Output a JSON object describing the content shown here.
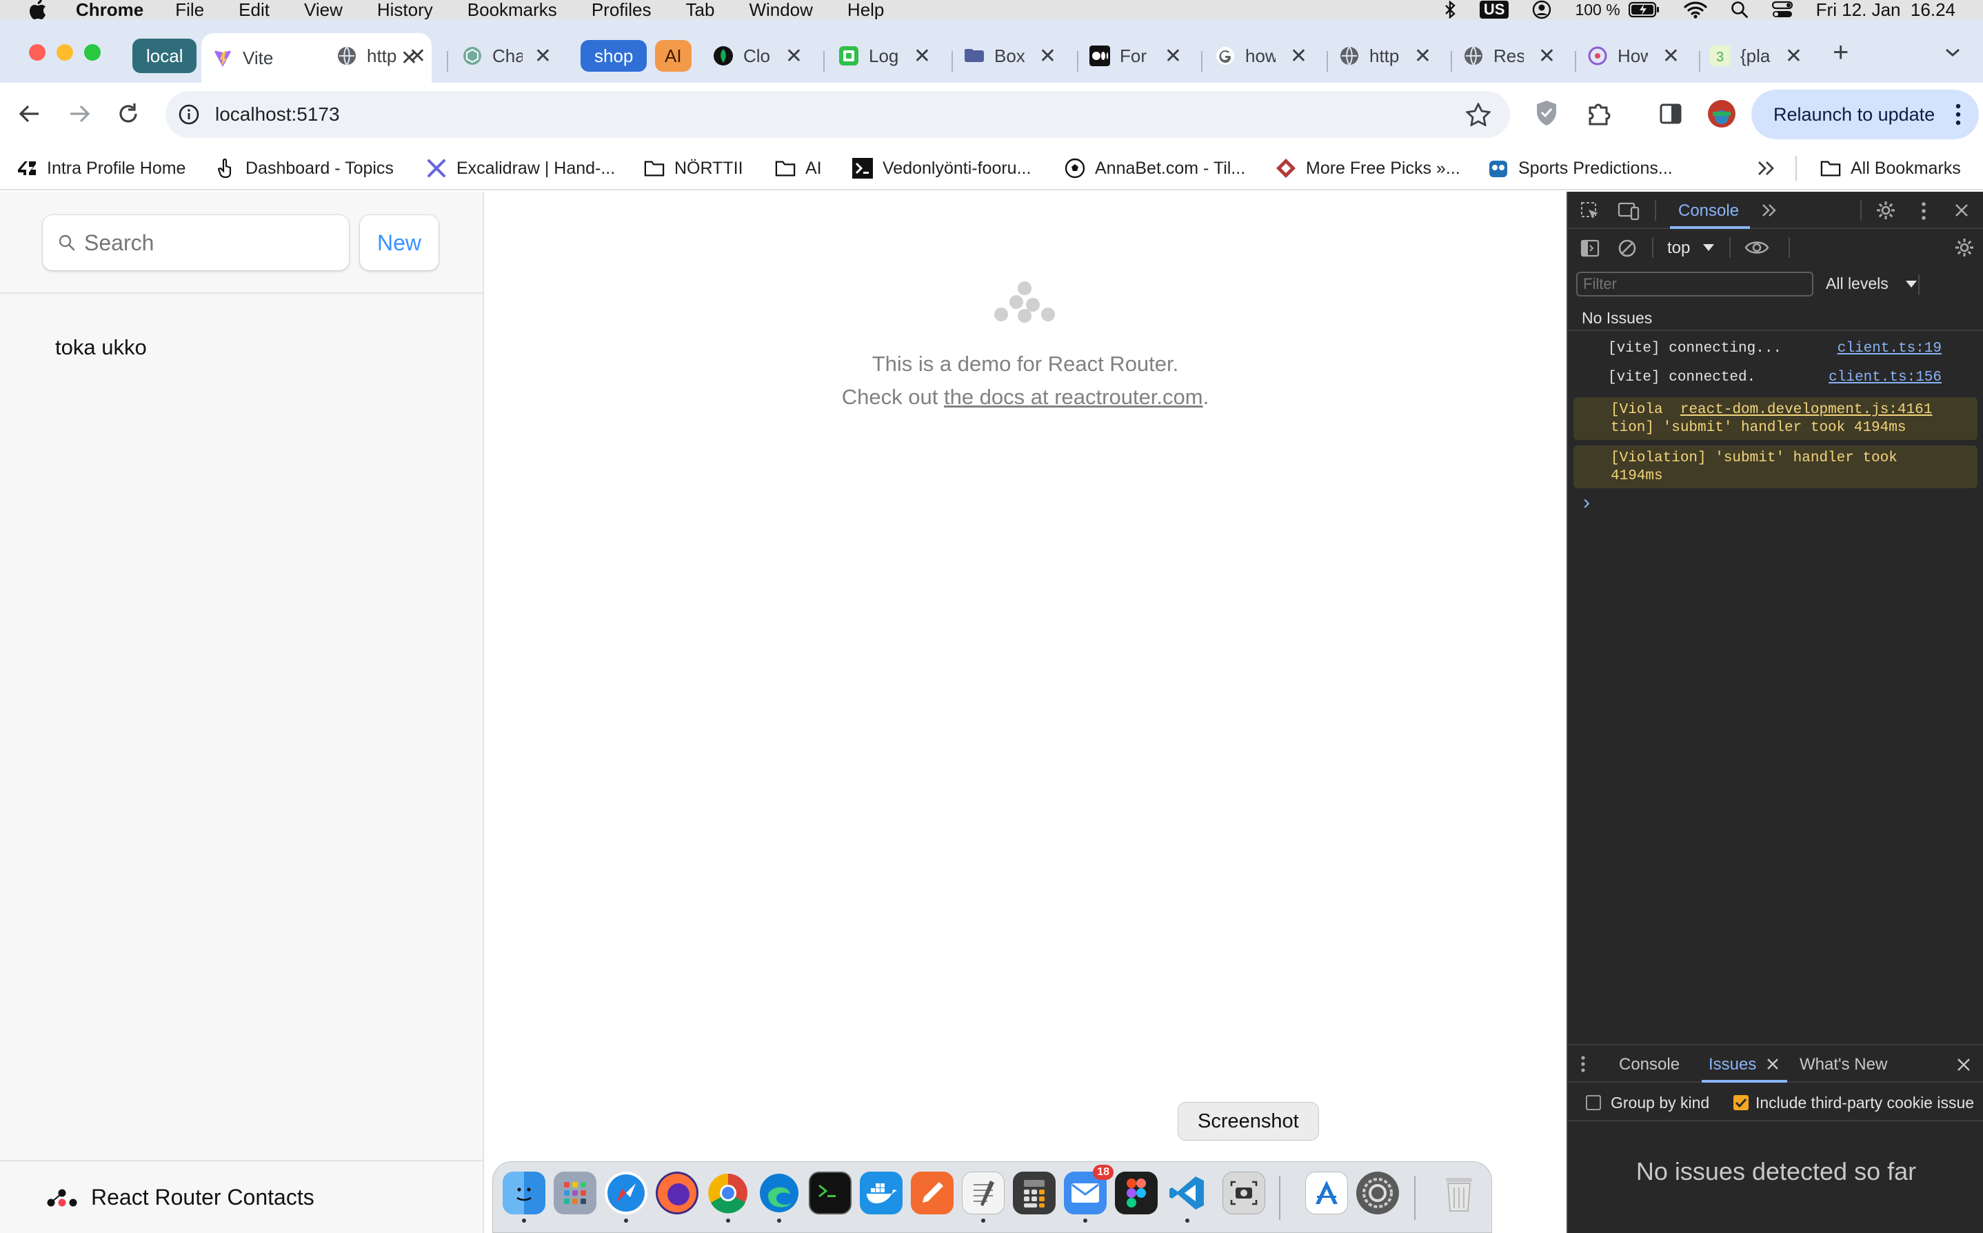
{
  "menubar": {
    "app_name": "Chrome",
    "items": [
      "File",
      "Edit",
      "View",
      "History",
      "Bookmarks",
      "Profiles",
      "Tab",
      "Window",
      "Help"
    ],
    "keyboard": "US",
    "battery": "100 %",
    "datetime": "Fri 12. Jan  16.24"
  },
  "tabs": {
    "group_local": "local",
    "group_shop": "shop",
    "group_ai": "AI",
    "titles": [
      "Vite",
      "http",
      "Cha",
      "Clo",
      "Log",
      "Box",
      "For",
      "how",
      "http",
      "Res",
      "How",
      "{pla"
    ],
    "close_glyph": "✕",
    "new_tab_glyph": "+",
    "colors": {
      "local": "#2f6d7a",
      "shop": "#2f6fd6",
      "ai": "#f29a4a"
    }
  },
  "toolbar": {
    "url": "localhost:5173",
    "relaunch_label": "Relaunch to update"
  },
  "bookmarks": {
    "items": [
      "Intra Profile Home",
      "Dashboard - Topics",
      "Excalidraw | Hand-...",
      "NÖRTTII",
      "AI",
      "Vedonlyönti-fooru...",
      "AnnaBet.com - Til...",
      "More Free Picks »...",
      "Sports Predictions..."
    ],
    "all_label": "All Bookmarks"
  },
  "sidebar": {
    "search_placeholder": "Search",
    "new_label": "New",
    "contacts": [
      "toka ukko"
    ],
    "footer": "React Router Contacts"
  },
  "main": {
    "line1": "This is a demo for React Router.",
    "line2_prefix": "Check out ",
    "docs_link": "the docs at reactrouter.com",
    "line2_suffix": "."
  },
  "devtools": {
    "active_tab": "Console",
    "context": "top",
    "filter_placeholder": "Filter",
    "levels": "All levels",
    "issues_banner": "No Issues",
    "logs": [
      {
        "text": "[vite] connecting...",
        "source": "client.ts:19"
      },
      {
        "text": "[vite] connected.",
        "source": "client.ts:156"
      }
    ],
    "warnings": [
      {
        "line1": "[Viola",
        "source": "react-dom.development.js:4161",
        "line2": "tion] 'submit' handler took 4194ms"
      },
      {
        "line1": "[Violation] 'submit' handler took",
        "line2": "4194ms"
      }
    ],
    "prompt": "›",
    "drawer_tabs": [
      "Console",
      "Issues",
      "What's New"
    ],
    "group_by_kind": "Group by kind",
    "include_third_party": "Include third-party cookie issue",
    "no_issues_detected": "No issues detected so far"
  },
  "dock": {
    "tooltip": "Screenshot",
    "mail_badge": "18",
    "apps": [
      "finder",
      "launchpad",
      "safari",
      "firefox",
      "chrome",
      "edge",
      "terminal",
      "docker",
      "pages",
      "textedit",
      "calculator",
      "mail",
      "figma",
      "vscode",
      "screenshot",
      "xcode",
      "system-settings",
      "trash"
    ]
  }
}
